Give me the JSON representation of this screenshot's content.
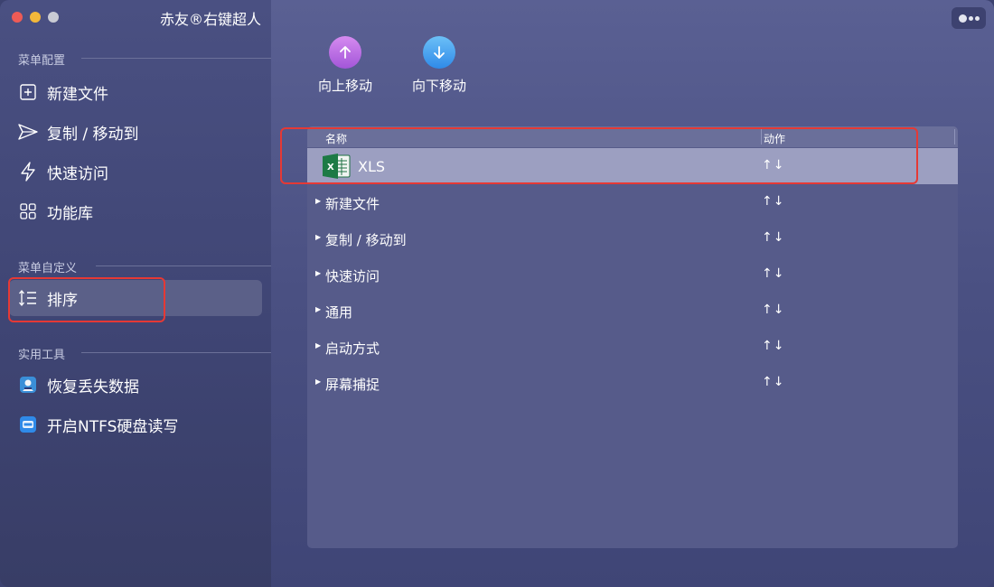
{
  "app": {
    "title": "赤友®右键超人"
  },
  "sidebar": {
    "sections": [
      {
        "label": "菜单配置"
      },
      {
        "label": "菜单自定义"
      },
      {
        "label": "实用工具"
      }
    ],
    "items": [
      {
        "label": "新建文件",
        "icon": "new-file-icon"
      },
      {
        "label": "复制 / 移动到",
        "icon": "send-icon"
      },
      {
        "label": "快速访问",
        "icon": "lightning-icon"
      },
      {
        "label": "功能库",
        "icon": "grid-icon"
      },
      {
        "label": "排序",
        "icon": "sort-icon",
        "selected": true
      },
      {
        "label": "恢复丢失数据",
        "icon": "recovery-app-icon"
      },
      {
        "label": "开启NTFS硬盘读写",
        "icon": "ntfs-app-icon"
      }
    ]
  },
  "toolbar": {
    "move_up_label": "向上移动",
    "move_down_label": "向下移动"
  },
  "table": {
    "columns": {
      "name": "名称",
      "action": "动作"
    },
    "rows": [
      {
        "label": "XLS",
        "actions": "↑↓",
        "selected": true,
        "icon": "excel-icon"
      },
      {
        "label": "新建文件",
        "actions": "↑↓"
      },
      {
        "label": "复制 / 移动到",
        "actions": "↑↓"
      },
      {
        "label": "快速访问",
        "actions": "↑↓"
      },
      {
        "label": "通用",
        "actions": "↑↓"
      },
      {
        "label": "启动方式",
        "actions": "↑↓"
      },
      {
        "label": "屏幕捕捉",
        "actions": "↑↓"
      }
    ]
  },
  "colors": {
    "highlight_box": "#e53935",
    "sidebar_bg": "#4a5082",
    "main_bg": "#5a6093"
  }
}
